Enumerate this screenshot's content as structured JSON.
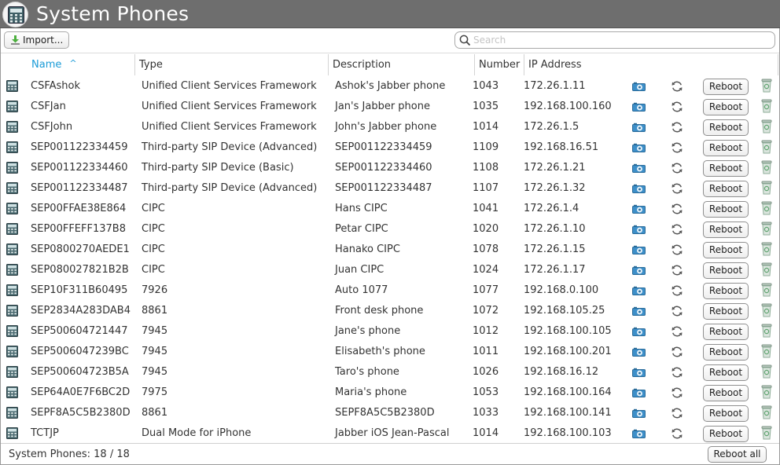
{
  "window": {
    "title": "System Phones"
  },
  "toolbar": {
    "import_label": "Import..."
  },
  "search": {
    "placeholder": "Search",
    "value": ""
  },
  "columns": {
    "name": "Name",
    "type": "Type",
    "description": "Description",
    "number": "Number",
    "ip": "IP Address"
  },
  "sort": {
    "column": "Name",
    "direction": "ascending",
    "indicator": "^"
  },
  "row_actions": {
    "reboot_label": "Reboot"
  },
  "rows": [
    {
      "name": "CSFAshok",
      "type": "Unified Client Services Framework",
      "description": "Ashok's Jabber phone",
      "number": "1043",
      "ip": "172.26.1.11"
    },
    {
      "name": "CSFJan",
      "type": "Unified Client Services Framework",
      "description": "Jan's Jabber phone",
      "number": "1035",
      "ip": "192.168.100.160"
    },
    {
      "name": "CSFJohn",
      "type": "Unified Client Services Framework",
      "description": "John's Jabber phone",
      "number": "1014",
      "ip": "172.26.1.5"
    },
    {
      "name": "SEP001122334459",
      "type": "Third-party SIP Device (Advanced)",
      "description": "SEP001122334459",
      "number": "1109",
      "ip": "192.168.16.51"
    },
    {
      "name": "SEP001122334460",
      "type": "Third-party SIP Device (Basic)",
      "description": "SEP001122334460",
      "number": "1108",
      "ip": "172.26.1.21"
    },
    {
      "name": "SEP001122334487",
      "type": "Third-party SIP Device (Advanced)",
      "description": "SEP001122334487",
      "number": "1107",
      "ip": "172.26.1.32"
    },
    {
      "name": "SEP00FFAE38E864",
      "type": "CIPC",
      "description": "Hans CIPC",
      "number": "1041",
      "ip": "172.26.1.4"
    },
    {
      "name": "SEP00FFEFF137B8",
      "type": "CIPC",
      "description": "Petar CIPC",
      "number": "1020",
      "ip": "172.26.1.10"
    },
    {
      "name": "SEP0800270AEDE1",
      "type": "CIPC",
      "description": "Hanako CIPC",
      "number": "1078",
      "ip": "172.26.1.15"
    },
    {
      "name": "SEP080027821B2B",
      "type": "CIPC",
      "description": "Juan CIPC",
      "number": "1024",
      "ip": "172.26.1.17"
    },
    {
      "name": "SEP10F311B60495",
      "type": "7926",
      "description": "Auto 1077",
      "number": "1077",
      "ip": "192.168.0.100"
    },
    {
      "name": "SEP2834A283DAB4",
      "type": "8861",
      "description": "Front desk phone",
      "number": "1072",
      "ip": "192.168.105.25"
    },
    {
      "name": "SEP500604721447",
      "type": "7945",
      "description": "Jane's phone",
      "number": "1012",
      "ip": "192.168.100.105"
    },
    {
      "name": "SEP5006047239BC",
      "type": "7945",
      "description": "Elisabeth's phone",
      "number": "1011",
      "ip": "192.168.100.201"
    },
    {
      "name": "SEP500604723B5A",
      "type": "7945",
      "description": "Taro's phone",
      "number": "1026",
      "ip": "192.168.16.12"
    },
    {
      "name": "SEP64A0E7F6BC2D",
      "type": "7975",
      "description": "Maria's phone",
      "number": "1053",
      "ip": "192.168.100.164"
    },
    {
      "name": "SEPF8A5C5B2380D",
      "type": "8861",
      "description": "SEPF8A5C5B2380D",
      "number": "1033",
      "ip": "192.168.100.141"
    },
    {
      "name": "TCTJP",
      "type": "Dual Mode for iPhone",
      "description": "Jabber iOS Jean-Pascal",
      "number": "1014",
      "ip": "192.168.100.103"
    }
  ],
  "footer": {
    "status": "System Phones: 18 / 18",
    "reboot_all_label": "Reboot all"
  },
  "icons": {
    "app": "phone-grid-icon",
    "import": "download-arrow-icon",
    "search": "magnifier-icon",
    "row": "desk-phone-icon",
    "screenshot": "camera-icon",
    "reset": "sync-icon",
    "delete": "trash-icon"
  },
  "colors": {
    "titlebar": "#6e6e6e",
    "sort_accent": "#1a9bd7",
    "camera": "#3d8fc9",
    "trash": "#8fae99"
  }
}
